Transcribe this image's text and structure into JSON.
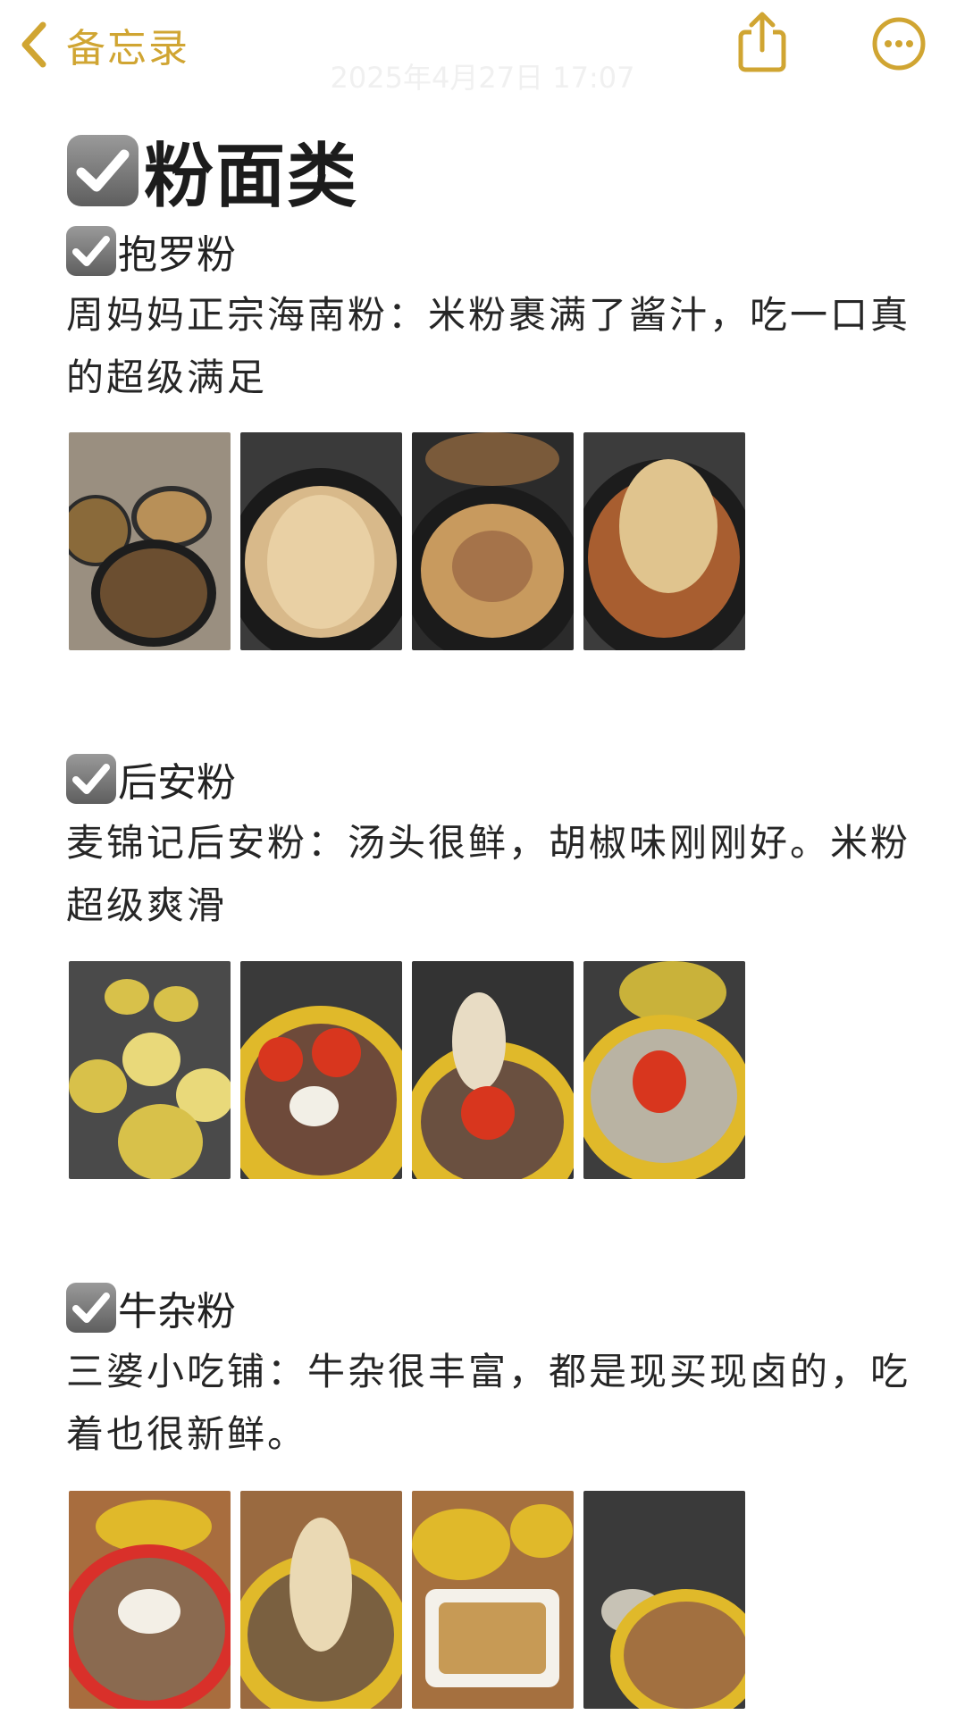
{
  "nav": {
    "back_label": "备忘录",
    "date": "2025年4月27日 17:07",
    "icons": {
      "back": "chevron-left-icon",
      "share": "share-icon",
      "more": "more-icon"
    },
    "accent": "#d0a532"
  },
  "note": {
    "title": "粉面类",
    "sections": [
      {
        "name": "抱罗粉",
        "desc": "周妈妈正宗海南粉：米粉裹满了酱汁，吃一口真的超级满足",
        "photos": [
          "food-photo-1",
          "food-photo-2",
          "food-photo-3",
          "food-photo-4"
        ]
      },
      {
        "name": "后安粉",
        "desc": "麦锦记后安粉：汤头很鲜，胡椒味刚刚好。米粉超级爽滑",
        "photos": [
          "food-photo-1",
          "food-photo-2",
          "food-photo-3",
          "food-photo-4"
        ]
      },
      {
        "name": "牛杂粉",
        "desc": "三婆小吃铺：牛杂很丰富，都是现买现卤的，吃着也很新鲜。",
        "photos": [
          "food-photo-1",
          "food-photo-2",
          "food-photo-3",
          "food-photo-4"
        ]
      }
    ]
  },
  "colors": {
    "checkbox": "#7a7a7a",
    "text": "#222222",
    "accent": "#d0a532"
  }
}
